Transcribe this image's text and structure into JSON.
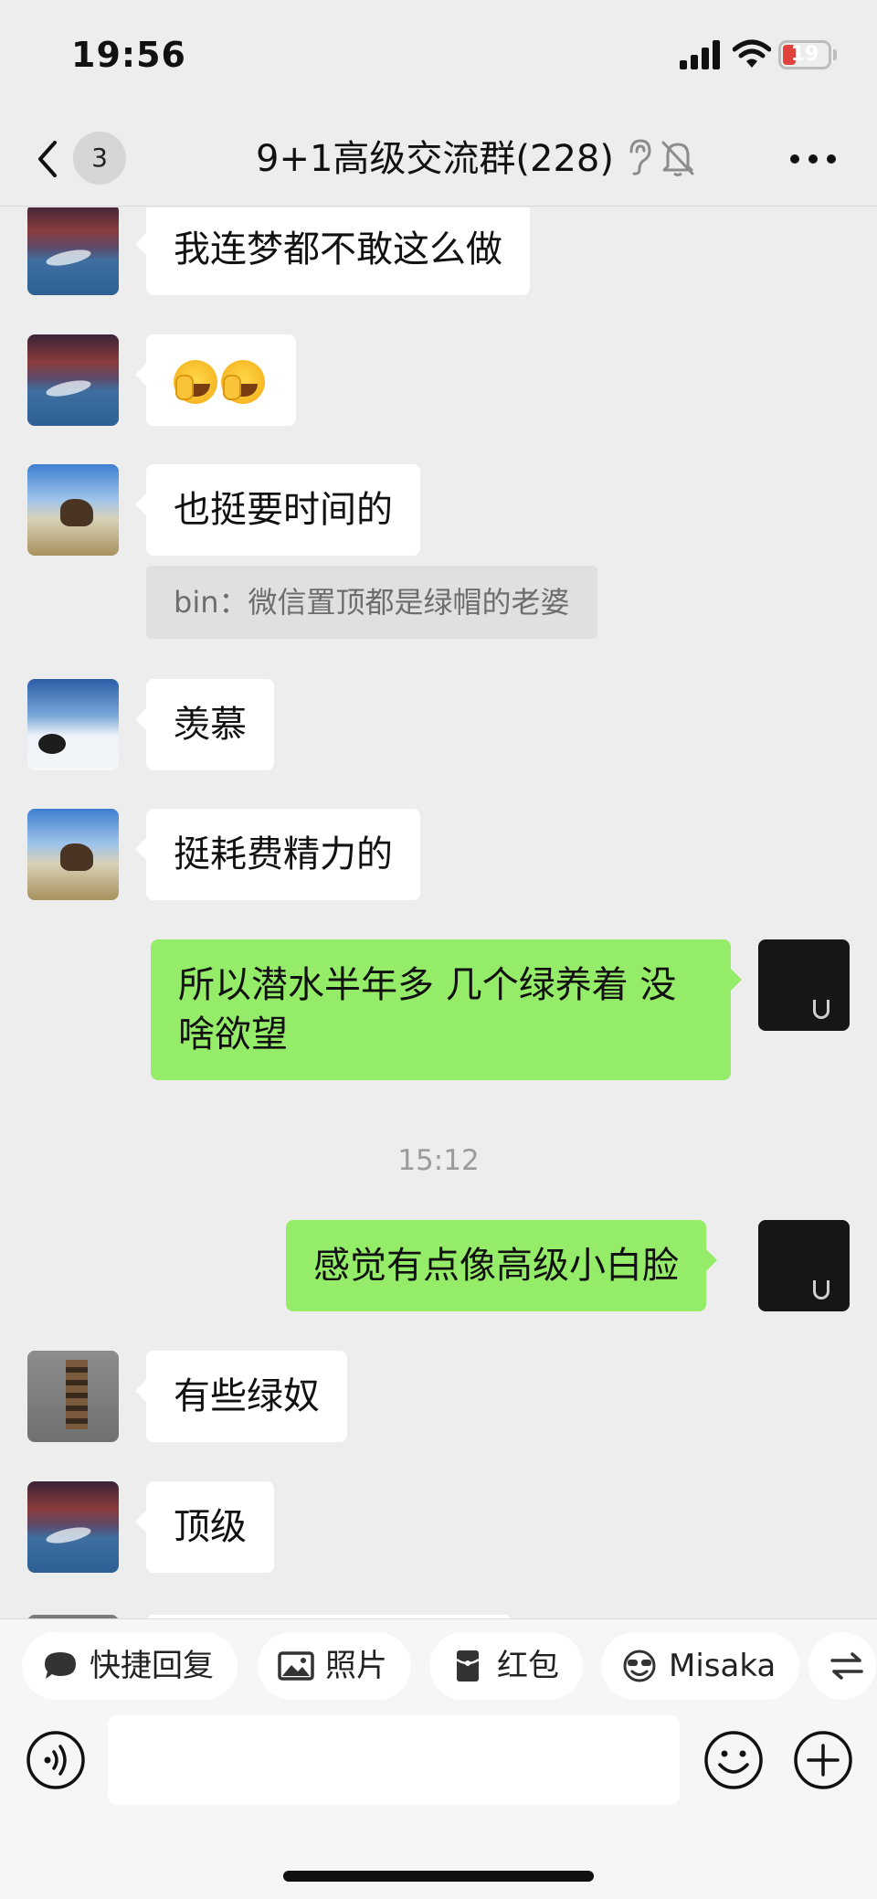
{
  "status_bar": {
    "time": "19:56",
    "battery": "19"
  },
  "header": {
    "back_badge": "3",
    "title": "9+1高级交流群(228)"
  },
  "messages": [
    {
      "text": "我连梦都不敢这么做"
    },
    {
      "text": ""
    },
    {
      "text": "也挺要时间的",
      "quote": "bin：微信置顶都是绿帽的老婆"
    },
    {
      "text": "羡慕"
    },
    {
      "text": "挺耗费精力的"
    },
    {
      "text": "所以潜水半年多 几个绿养着 没啥欲望"
    },
    {
      "timestamp": "15:12"
    },
    {
      "text": "感觉有点像高级小白脸"
    },
    {
      "text": "有些绿奴"
    },
    {
      "text": "顶级"
    }
  ],
  "quick_actions": [
    {
      "label": "快捷回复",
      "icon": "chat-bubble-icon"
    },
    {
      "label": "照片",
      "icon": "image-icon"
    },
    {
      "label": "红包",
      "icon": "red-packet-icon"
    },
    {
      "label": "Misaka",
      "icon": "sunglasses-icon"
    },
    {
      "label": "",
      "icon": "transfer-icon"
    }
  ],
  "input": {
    "placeholder": ""
  },
  "icons": {
    "back": "chevron-left-icon",
    "ear": "ear-icon",
    "mute": "bell-off-icon",
    "more": "more-icon",
    "voice": "voice-icon",
    "emoji": "smiley-icon",
    "plus": "plus-icon"
  },
  "colors": {
    "background": "#ededed",
    "incoming_bubble": "#ffffff",
    "outgoing_bubble": "#95ec69",
    "quote_bg": "#e0e0e0",
    "timestamp": "#9b9b9b"
  }
}
